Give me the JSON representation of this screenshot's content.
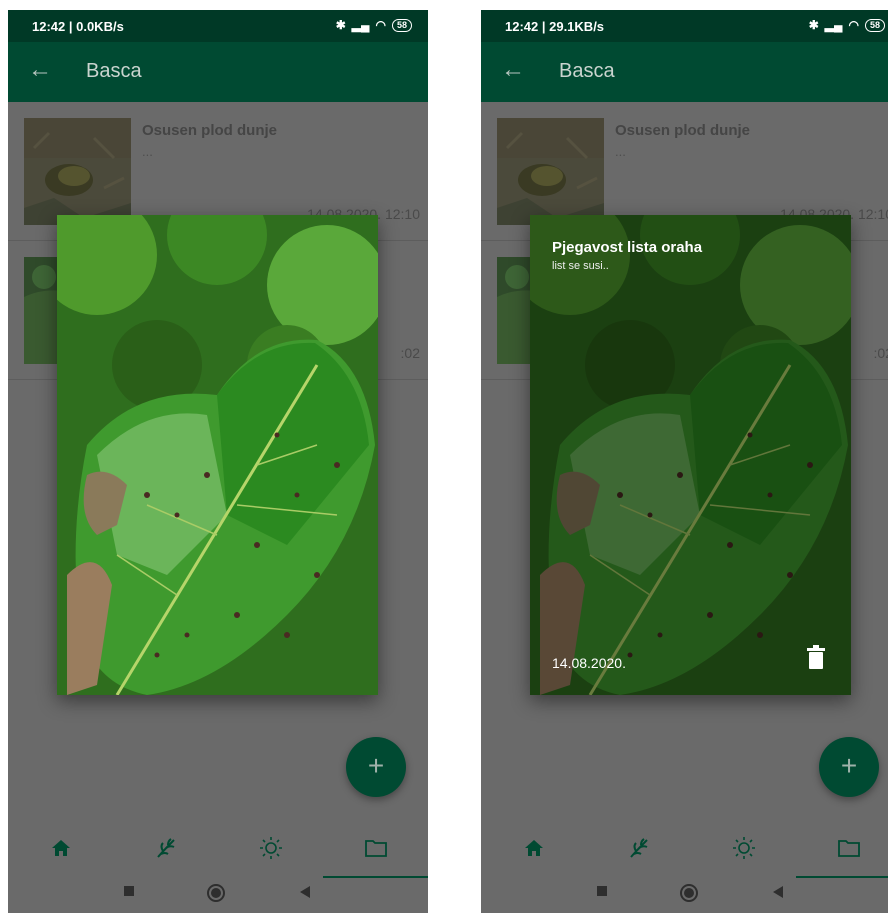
{
  "screens": [
    {
      "status": {
        "time": "12:42 | 0.0KB/s",
        "battery": "58"
      },
      "appbar": {
        "back_icon": "arrow-left-icon",
        "title": "Basca"
      },
      "list": [
        {
          "title": "Osusen plod dunje",
          "subtitle": "...",
          "date": "14.08.2020. 12:10"
        },
        {
          "title": "",
          "subtitle": "",
          "date": ":02"
        }
      ],
      "dialog": {
        "show_info": false,
        "title": "",
        "subtitle": "",
        "date": ""
      },
      "fab": {
        "label": "+"
      }
    },
    {
      "status": {
        "time": "12:42 | 29.1KB/s",
        "battery": "58"
      },
      "appbar": {
        "back_icon": "arrow-left-icon",
        "title": "Basca"
      },
      "list": [
        {
          "title": "Osusen plod dunje",
          "subtitle": "...",
          "date": "14.08.2020. 12:10"
        },
        {
          "title": "",
          "subtitle": "",
          "date": ":02"
        }
      ],
      "dialog": {
        "show_info": true,
        "title": "Pjegavost lista oraha",
        "subtitle": "list se susi..",
        "date": "14.08.2020."
      },
      "fab": {
        "label": "+"
      }
    }
  ],
  "bottom_nav": [
    {
      "name": "home",
      "icon": "home-icon",
      "active": false
    },
    {
      "name": "plants",
      "icon": "sprout-icon",
      "active": false
    },
    {
      "name": "weather",
      "icon": "sun-icon",
      "active": false
    },
    {
      "name": "folder",
      "icon": "folder-icon",
      "active": true
    }
  ],
  "system_nav": [
    "recents-icon",
    "home-circle-icon",
    "back-triangle-icon"
  ],
  "colors": {
    "primary": "#004a32",
    "status": "#003926",
    "scrim": "#6a6a6a"
  }
}
